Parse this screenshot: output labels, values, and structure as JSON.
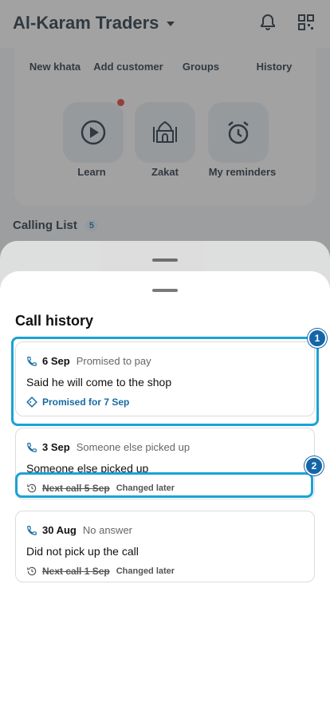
{
  "app": {
    "title": "Al-Karam Traders"
  },
  "tools": {
    "row1": [
      "New khata",
      "Add customer",
      "Groups",
      "History"
    ],
    "row2": [
      "Learn",
      "Zakat",
      "My reminders"
    ]
  },
  "calling_list": {
    "title": "Calling List",
    "count": "5"
  },
  "sheet": {
    "title": "Call history",
    "cards": [
      {
        "date": "6 Sep",
        "status": "Promised to pay",
        "note": "Said he will come to the shop",
        "footer": "Promised for 7 Sep",
        "footer_type": "promise"
      },
      {
        "date": "3 Sep",
        "status": "Someone else picked up",
        "note": "Someone else picked up",
        "footer": "Next call 5 Sep",
        "footer_extra": "Changed later",
        "footer_type": "nextcall"
      },
      {
        "date": "30 Aug",
        "status": "No answer",
        "note": "Did not pick up the call",
        "footer": "Next call 1 Sep",
        "footer_extra": "Changed later",
        "footer_type": "nextcall"
      }
    ]
  },
  "markers": [
    "1",
    "2"
  ],
  "colors": {
    "accent": "#176aa3",
    "highlight": "#1aa3d6",
    "marker": "#1565a8"
  }
}
